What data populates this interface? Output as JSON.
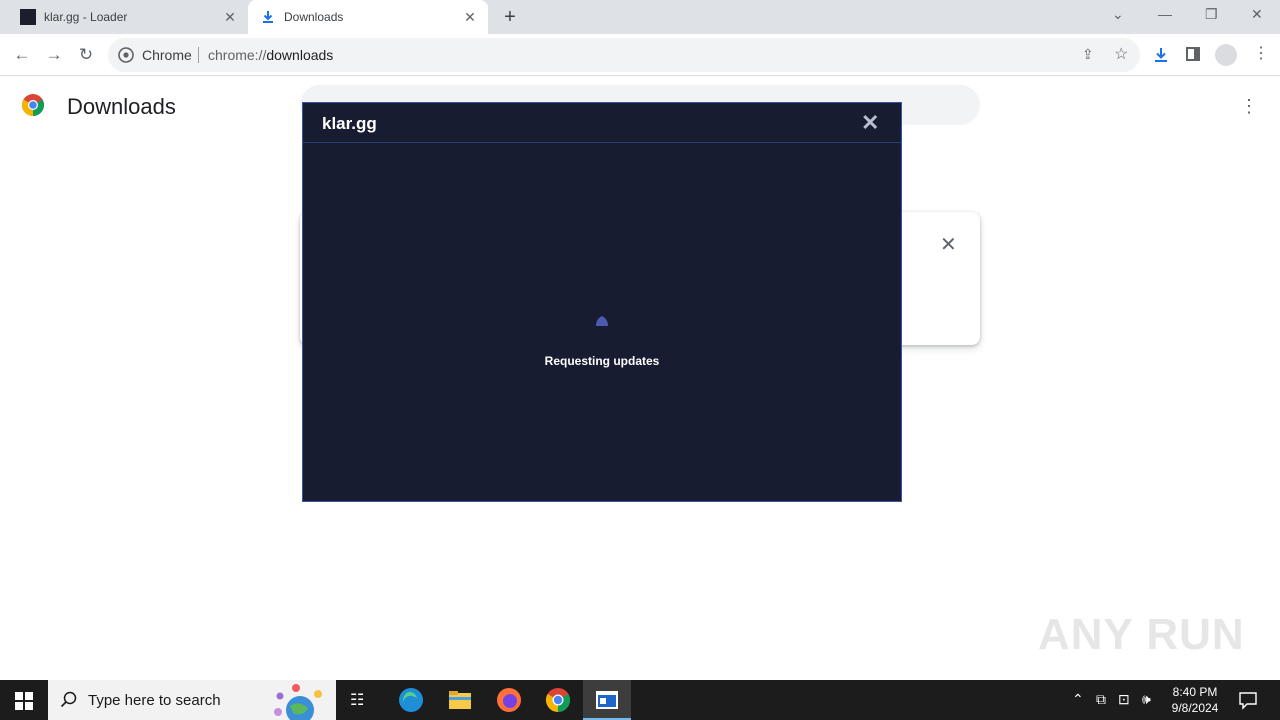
{
  "tabs": [
    {
      "label": "klar.gg - Loader",
      "active": false
    },
    {
      "label": "Downloads",
      "active": true
    }
  ],
  "toolbar": {
    "site_chip": "Chrome",
    "url_scheme": "chrome://",
    "url_host": "downloads"
  },
  "page": {
    "title": "Downloads"
  },
  "loader": {
    "title": "klar.gg",
    "status": "Requesting updates",
    "accent_color": "#3a55a8",
    "background_color": "#171c30"
  },
  "watermark": "ANY RUN",
  "taskbar": {
    "search_placeholder": "Type here to search",
    "time": "8:40 PM",
    "date": "9/8/2024"
  }
}
